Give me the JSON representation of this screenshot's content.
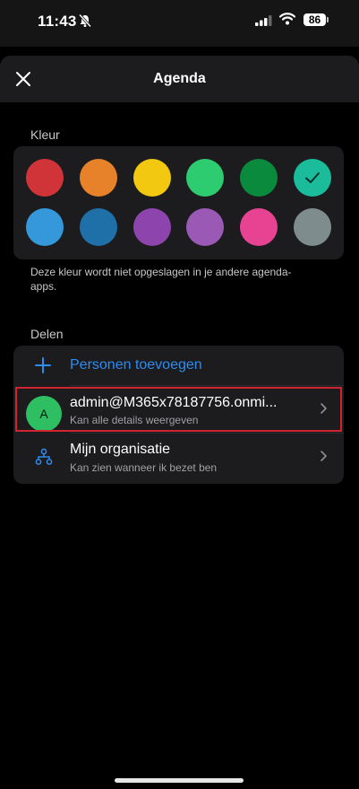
{
  "status": {
    "time": "11:43",
    "battery": "86"
  },
  "header": {
    "title": "Agenda",
    "close_icon": "close-icon"
  },
  "color_section": {
    "label": "Kleur",
    "swatches": [
      {
        "name": "red",
        "color": "#d13438"
      },
      {
        "name": "orange",
        "color": "#e8822a"
      },
      {
        "name": "yellow",
        "color": "#f2c811"
      },
      {
        "name": "light-green",
        "color": "#2ecc71"
      },
      {
        "name": "dark-green",
        "color": "#0a8a3c"
      },
      {
        "name": "teal",
        "color": "#1abc9c",
        "selected": true
      },
      {
        "name": "light-blue",
        "color": "#3498db"
      },
      {
        "name": "dark-blue",
        "color": "#1f6fa8"
      },
      {
        "name": "purple",
        "color": "#8e44ad"
      },
      {
        "name": "light-purple",
        "color": "#9b59b6"
      },
      {
        "name": "pink",
        "color": "#e84393"
      },
      {
        "name": "gray",
        "color": "#7f8c8d"
      }
    ],
    "note": "Deze kleur wordt niet opgeslagen in je andere agenda-apps."
  },
  "share_section": {
    "label": "Delen",
    "add_people_label": "Personen toevoegen",
    "items": [
      {
        "avatar_letter": "A",
        "title": "admin@M365x78187756.onmi...",
        "subtitle": "Kan alle details weergeven"
      },
      {
        "title": "Mijn organisatie",
        "subtitle": "Kan zien wanneer ik bezet ben"
      }
    ]
  },
  "colors": {
    "accent": "#2d8cf0",
    "highlight": "#d1242f"
  }
}
